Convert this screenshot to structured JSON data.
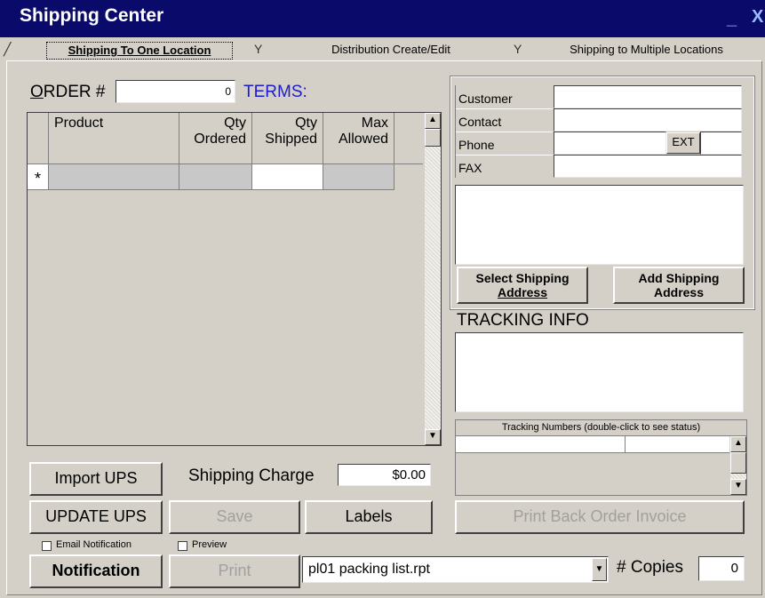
{
  "window": {
    "title": "Shipping Center",
    "minimize": "_",
    "close": "X"
  },
  "tabs": [
    {
      "label": "Shipping To One Location"
    },
    {
      "label": "Distribution Create/Edit"
    },
    {
      "label": "Shipping to Multiple Locations"
    }
  ],
  "order": {
    "label": "ORDER #",
    "value": "0",
    "terms_label": "TERMS:"
  },
  "grid": {
    "columns": [
      "Product",
      "Qty\nOrdered",
      "Qty\nShipped",
      "Max\nAllowed"
    ],
    "new_row_marker": "*"
  },
  "customer": {
    "customer_label": "Customer",
    "contact_label": "Contact",
    "phone_label": "Phone",
    "ext_label": "EXT",
    "fax_label": "FAX",
    "select_shipping": [
      "Select Shipping",
      "Address"
    ],
    "add_shipping": [
      "Add Shipping",
      "Address"
    ]
  },
  "tracking": {
    "title": "TRACKING INFO",
    "numbers_header": "Tracking Numbers (double-click to see status)"
  },
  "buttons": {
    "import_ups": "Import UPS",
    "update_ups": "UPDATE UPS",
    "save": "Save",
    "labels": "Labels",
    "print_back_order": "Print Back Order Invoice",
    "notification": "Notification",
    "print": "Print"
  },
  "shipping_charge": {
    "label": "Shipping Charge",
    "value": "$0.00"
  },
  "options": {
    "email_notification": "Email Notification",
    "preview": "Preview"
  },
  "report": {
    "selected": "pl01 packing list.rpt"
  },
  "copies": {
    "label": "# Copies",
    "value": "0"
  }
}
